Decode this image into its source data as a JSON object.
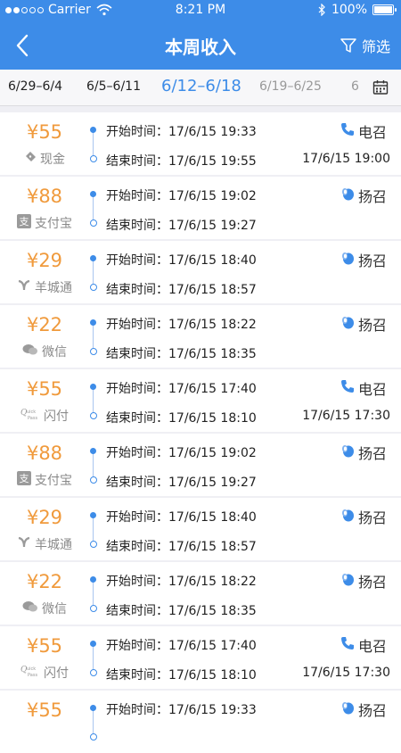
{
  "status_bar": {
    "carrier": "Carrier",
    "time": "8:21 PM",
    "battery": "100%"
  },
  "nav": {
    "title": "本周收入",
    "filter_label": "筛选"
  },
  "weeks": [
    {
      "label": "6/29–6/4",
      "state": "normal"
    },
    {
      "label": "6/5–6/11",
      "state": "normal"
    },
    {
      "label": "6/12–6/18",
      "state": "active"
    },
    {
      "label": "6/19–6/25",
      "state": "faded"
    },
    {
      "label": "6",
      "state": "faded"
    }
  ],
  "labels": {
    "start": "开始时间：",
    "end": "结束时间："
  },
  "orders": [
    {
      "amount": "¥55",
      "pay": "现金",
      "pay_icon": "cash-icon",
      "start": "17/6/15  19:33",
      "end": "17/6/15  19:55",
      "type": "电召",
      "type_icon": "phone-icon",
      "book_time": "17/6/15  19:00"
    },
    {
      "amount": "¥88",
      "pay": "支付宝",
      "pay_icon": "alipay-icon",
      "start": "17/6/15  19:02",
      "end": "17/6/15  19:27",
      "type": "扬召",
      "type_icon": "hand-icon",
      "book_time": ""
    },
    {
      "amount": "¥29",
      "pay": "羊城通",
      "pay_icon": "yangchengtong-icon",
      "start": "17/6/15  18:40",
      "end": "17/6/15  18:57",
      "type": "扬召",
      "type_icon": "hand-icon",
      "book_time": ""
    },
    {
      "amount": "¥22",
      "pay": "微信",
      "pay_icon": "wechat-icon",
      "start": "17/6/15  18:22",
      "end": "17/6/15  18:35",
      "type": "扬召",
      "type_icon": "hand-icon",
      "book_time": ""
    },
    {
      "amount": "¥55",
      "pay": "闪付",
      "pay_icon": "quickpass-icon",
      "start": "17/6/15  17:40",
      "end": "17/6/15  18:10",
      "type": "电召",
      "type_icon": "phone-icon",
      "book_time": "17/6/15  17:30"
    },
    {
      "amount": "¥88",
      "pay": "支付宝",
      "pay_icon": "alipay-icon",
      "start": "17/6/15  19:02",
      "end": "17/6/15  19:27",
      "type": "扬召",
      "type_icon": "hand-icon",
      "book_time": ""
    },
    {
      "amount": "¥29",
      "pay": "羊城通",
      "pay_icon": "yangchengtong-icon",
      "start": "17/6/15  18:40",
      "end": "17/6/15  18:57",
      "type": "扬召",
      "type_icon": "hand-icon",
      "book_time": ""
    },
    {
      "amount": "¥22",
      "pay": "微信",
      "pay_icon": "wechat-icon",
      "start": "17/6/15  18:22",
      "end": "17/6/15  18:35",
      "type": "扬召",
      "type_icon": "hand-icon",
      "book_time": ""
    },
    {
      "amount": "¥55",
      "pay": "闪付",
      "pay_icon": "quickpass-icon",
      "start": "17/6/15  17:40",
      "end": "17/6/15  18:10",
      "type": "电召",
      "type_icon": "phone-icon",
      "book_time": "17/6/15  17:30"
    },
    {
      "amount": "¥55",
      "pay": "",
      "pay_icon": "",
      "start": "17/6/15  19:33",
      "end": "",
      "type": "扬召",
      "type_icon": "hand-icon",
      "book_time": ""
    }
  ],
  "colors": {
    "primary": "#3d8ce8",
    "amount": "#f09a3c",
    "background": "#efeff4"
  }
}
